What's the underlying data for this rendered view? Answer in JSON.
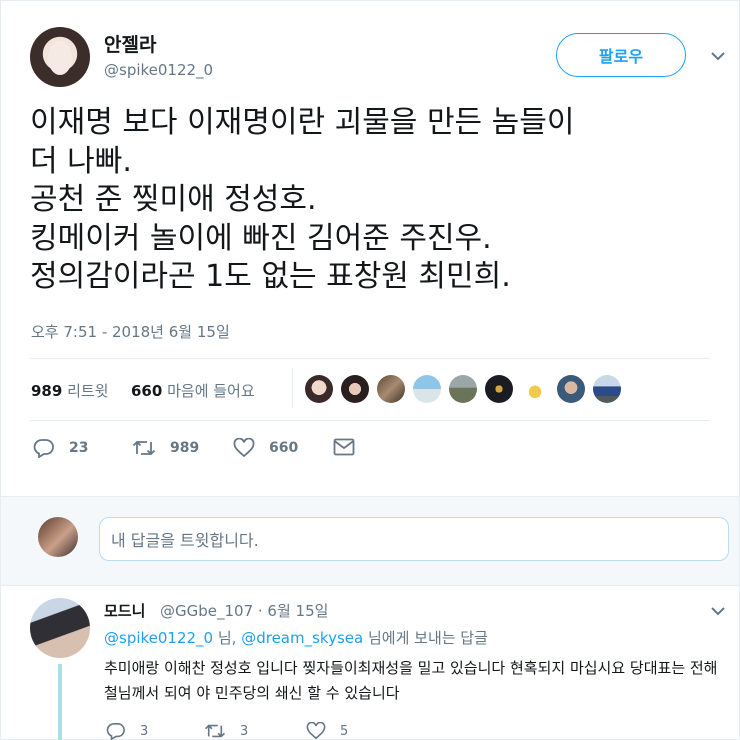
{
  "author": {
    "display_name": "안젤라",
    "handle": "@spike0122_0",
    "follow_label": "팔로우"
  },
  "tweet": {
    "text": "이재명 보다 이재명이란 괴물을 만든 놈들이\n더 나빠.\n공천 준 찢미애 정성호.\n킹메이커 놀이에 빠진 김어준 주진우.\n정의감이라곤 1도 없는 표창원 최민희.",
    "timestamp": "오후 7:51 - 2018년 6월 15일",
    "retweets_count": "989",
    "retweets_label": "리트윗",
    "likes_count": "660",
    "likes_label": "마음에 들어요",
    "actions": {
      "reply_count": "23",
      "retweet_count": "989",
      "like_count": "660"
    }
  },
  "liker_avatars": [
    "avatar-1",
    "avatar-2",
    "avatar-3",
    "avatar-4",
    "avatar-5",
    "avatar-6",
    "avatar-7",
    "avatar-8",
    "avatar-9"
  ],
  "reply_box": {
    "placeholder": "내 답글을 트윗합니다."
  },
  "reply": {
    "display_name": "모드니",
    "meta": "@GGbe_107 · 6월 15일",
    "reply_to_user1": "@spike0122_0",
    "reply_to_sep": " 님, ",
    "reply_to_user2": "@dream_skysea",
    "reply_to_suffix": " 님에게 보내는 답글",
    "text": "추미애랑 이해찬 정성호 입니다 찢자들이최재성을 밀고 있습니다 현혹되지 마십시요 당대표는 전해철님께서 되여 야 민주당의 쇄신 할 수 있습니다",
    "reply_count": "3",
    "retweet_count": "3",
    "like_count": "5"
  },
  "colors": {
    "accent": "#1da1f2",
    "muted": "#657786",
    "thread_line": "#a8e0e6"
  }
}
